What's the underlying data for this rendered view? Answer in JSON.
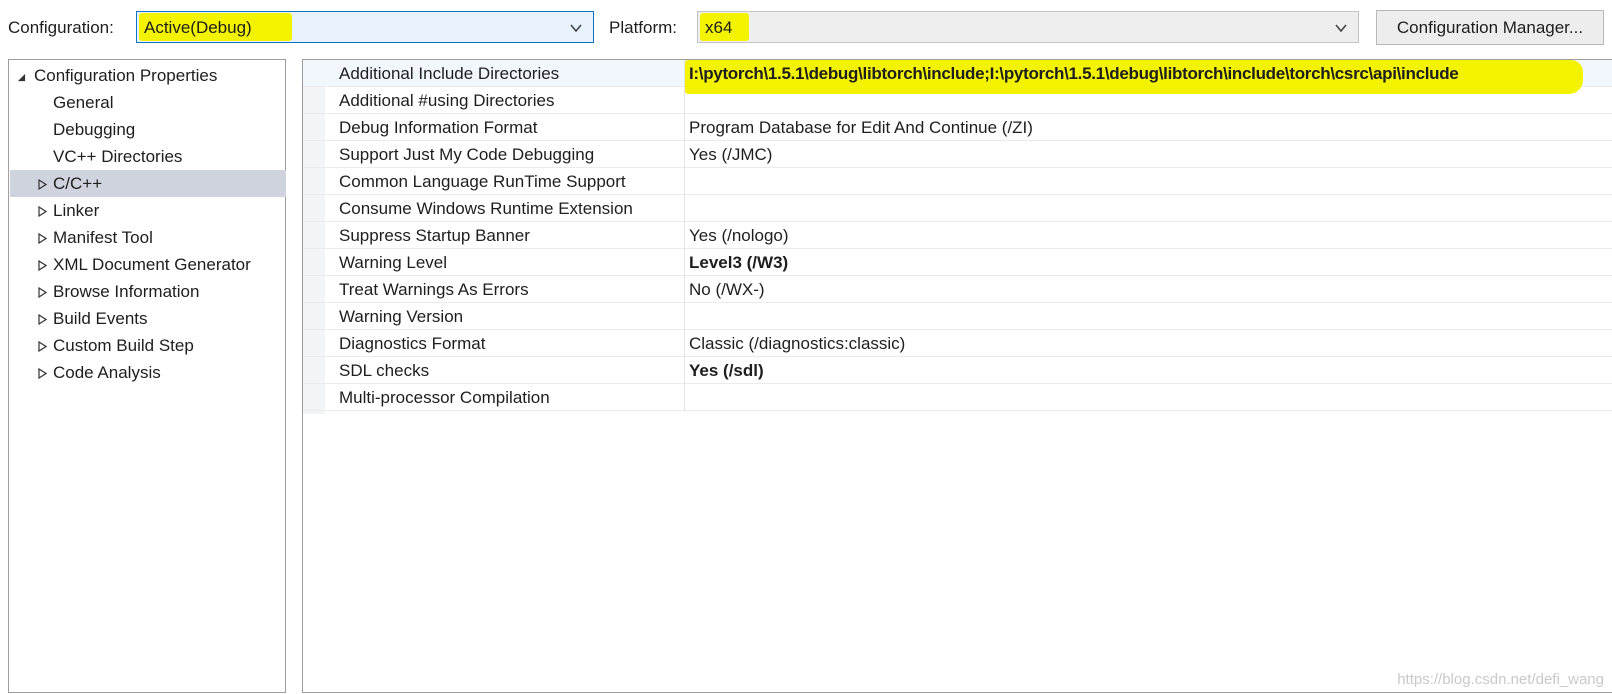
{
  "toolbar": {
    "configuration_label": "Configuration:",
    "configuration_value": "Active(Debug)",
    "platform_label": "Platform:",
    "platform_value": "x64",
    "configuration_manager_label": "Configuration Manager..."
  },
  "tree": {
    "root": "Configuration Properties",
    "items": [
      {
        "label": "General",
        "expandable": false
      },
      {
        "label": "Debugging",
        "expandable": false
      },
      {
        "label": "VC++ Directories",
        "expandable": false
      },
      {
        "label": "C/C++",
        "expandable": true,
        "selected": true
      },
      {
        "label": "Linker",
        "expandable": true
      },
      {
        "label": "Manifest Tool",
        "expandable": true
      },
      {
        "label": "XML Document Generator",
        "expandable": true
      },
      {
        "label": "Browse Information",
        "expandable": true
      },
      {
        "label": "Build Events",
        "expandable": true
      },
      {
        "label": "Custom Build Step",
        "expandable": true
      },
      {
        "label": "Code Analysis",
        "expandable": true
      }
    ]
  },
  "properties": [
    {
      "name": "Additional Include Directories",
      "value": "I:\\pytorch\\1.5.1\\debug\\libtorch\\include;I:\\pytorch\\1.5.1\\debug\\libtorch\\include\\torch\\csrc\\api\\include",
      "bold": true,
      "highlight": true
    },
    {
      "name": "Additional #using Directories",
      "value": ""
    },
    {
      "name": "Debug Information Format",
      "value": "Program Database for Edit And Continue (/ZI)"
    },
    {
      "name": "Support Just My Code Debugging",
      "value": "Yes (/JMC)"
    },
    {
      "name": "Common Language RunTime Support",
      "value": ""
    },
    {
      "name": "Consume Windows Runtime Extension",
      "value": ""
    },
    {
      "name": "Suppress Startup Banner",
      "value": "Yes (/nologo)"
    },
    {
      "name": "Warning Level",
      "value": "Level3 (/W3)",
      "bold": true
    },
    {
      "name": "Treat Warnings As Errors",
      "value": "No (/WX-)"
    },
    {
      "name": "Warning Version",
      "value": ""
    },
    {
      "name": "Diagnostics Format",
      "value": "Classic (/diagnostics:classic)"
    },
    {
      "name": "SDL checks",
      "value": "Yes (/sdl)",
      "bold": true
    },
    {
      "name": "Multi-processor Compilation",
      "value": ""
    }
  ],
  "watermark": "https://blog.csdn.net/defi_wang",
  "colors": {
    "highlight": "#f3f300",
    "selection": "#cfd3dd",
    "focus_border": "#0b73c6"
  },
  "icons": [
    "chevron-down-icon",
    "expand-triangle-icon",
    "collapse-triangle-icon"
  ]
}
